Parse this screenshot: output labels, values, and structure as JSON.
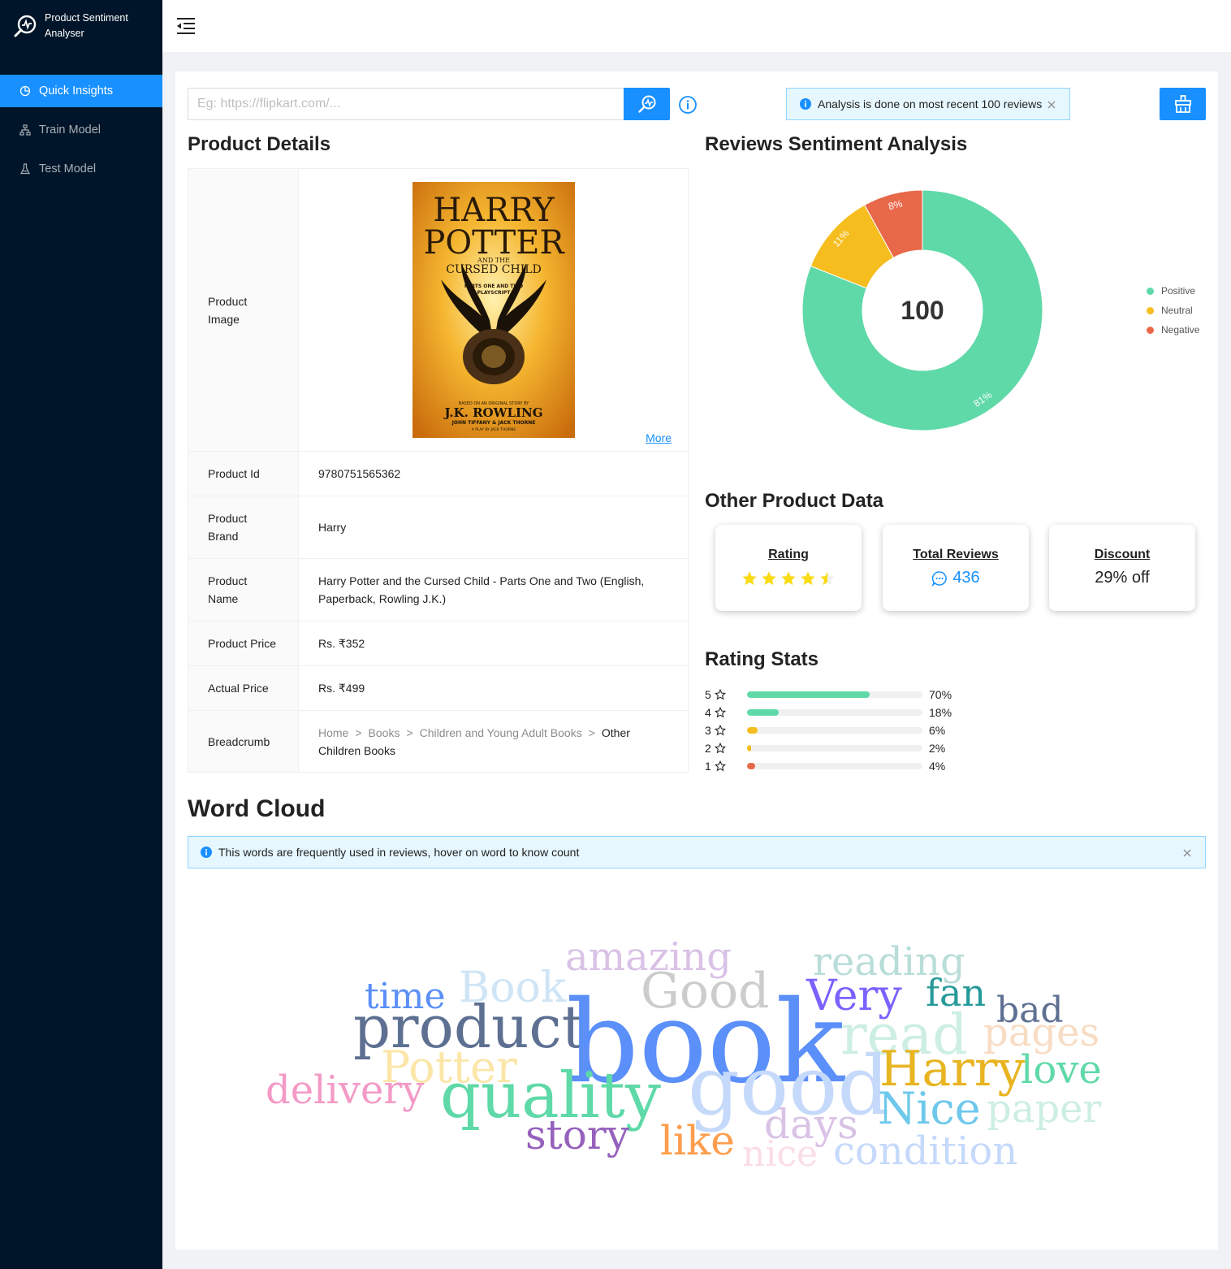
{
  "app": {
    "title": "Product Sentiment Analyser"
  },
  "menu": [
    {
      "label": "Quick Insights",
      "icon": "pie-chart-icon",
      "active": true
    },
    {
      "label": "Train Model",
      "icon": "cluster-icon",
      "active": false
    },
    {
      "label": "Test Model",
      "icon": "experiment-icon",
      "active": false
    }
  ],
  "search": {
    "placeholder": "Eg: https://flipkart.com/...",
    "value": ""
  },
  "alert_top": {
    "text": "Analysis is done on most recent 100 reviews"
  },
  "sections": {
    "product_details": "Product Details",
    "sentiment": "Reviews Sentiment Analysis",
    "other": "Other Product Data",
    "rating_stats": "Rating Stats",
    "word_cloud": "Word Cloud"
  },
  "product": {
    "image_label": "Product Image",
    "more": "More",
    "rows": [
      {
        "label": "Product Id",
        "value": "9780751565362"
      },
      {
        "label": "Product Brand",
        "value": "Harry"
      },
      {
        "label": "Product Name",
        "value": "Harry Potter and the Cursed Child - Parts One and Two  (English, Paperback, Rowling J.K.)"
      },
      {
        "label": "Product Price",
        "value": "Rs. ₹352"
      },
      {
        "label": "Actual Price",
        "value": "Rs. ₹499"
      }
    ],
    "breadcrumb_label": "Breadcrumb",
    "breadcrumb": [
      "Home",
      "Books",
      "Children and Young Adult Books",
      "Other Children Books"
    ],
    "cover": {
      "title1": "HARRY",
      "title2": "POTTER",
      "and_the": "AND THE",
      "subtitle": "CURSED CHILD",
      "parts1": "PARTS ONE AND TWO",
      "parts2": "PLAYSCRIPT",
      "based": "BASED ON AN ORIGINAL STORY BY",
      "author": "J.K. ROWLING",
      "coauthors": "JOHN TIFFANY & JACK THORNE",
      "play": "A PLAY BY JACK THORNE"
    }
  },
  "chart_data": {
    "type": "pie",
    "center_label": "100",
    "series": [
      {
        "name": "Positive",
        "value": 81,
        "label": "81%",
        "color": "#5fd9a8"
      },
      {
        "name": "Neutral",
        "value": 11,
        "label": "11%",
        "color": "#f5bd1e"
      },
      {
        "name": "Negative",
        "value": 8,
        "label": "8%",
        "color": "#e8684a"
      }
    ],
    "legend_position": "right"
  },
  "cards": {
    "rating": {
      "title": "Rating",
      "stars": 4.5
    },
    "reviews": {
      "title": "Total Reviews",
      "value": "436"
    },
    "discount": {
      "title": "Discount",
      "value": "29% off"
    }
  },
  "rating_stats": [
    {
      "stars": "5",
      "percent": 70,
      "label": "70%",
      "color": "#5fd9a8"
    },
    {
      "stars": "4",
      "percent": 18,
      "label": "18%",
      "color": "#5fd9a8"
    },
    {
      "stars": "3",
      "percent": 6,
      "label": "6%",
      "color": "#f5bd1e"
    },
    {
      "stars": "2",
      "percent": 2,
      "label": "2%",
      "color": "#f5bd1e"
    },
    {
      "stars": "1",
      "percent": 4,
      "label": "4%",
      "color": "#e8684a"
    }
  ],
  "alert_wc": {
    "text": "This words are frequently used in reviews, hover on word to know count"
  },
  "word_cloud": [
    {
      "word": "amazing",
      "color": "#d9c2e6"
    },
    {
      "word": "reading",
      "color": "#b9ddd8"
    },
    {
      "word": "time",
      "color": "#5b8ff9"
    },
    {
      "word": "Book",
      "color": "#cfe5f5"
    },
    {
      "word": "Good",
      "color": "#cccccc"
    },
    {
      "word": "Very",
      "color": "#7b61ff"
    },
    {
      "word": "fan",
      "color": "#269a99"
    },
    {
      "word": "bad",
      "color": "#5d7092"
    },
    {
      "word": "product",
      "color": "#5d7092"
    },
    {
      "word": "book",
      "color": "#5b8ff9"
    },
    {
      "word": "read",
      "color": "#cdeee4"
    },
    {
      "word": "pages",
      "color": "#f8dcc3"
    },
    {
      "word": "Potter",
      "color": "#fbe6a8"
    },
    {
      "word": "Harry",
      "color": "#e8b420"
    },
    {
      "word": "love",
      "color": "#5fd9a8"
    },
    {
      "word": "delivery",
      "color": "#f39ac6"
    },
    {
      "word": "quality",
      "color": "#5fd9a8"
    },
    {
      "word": "good",
      "color": "#c5d9fb"
    },
    {
      "word": "Nice",
      "color": "#6dc8ec"
    },
    {
      "word": "paper",
      "color": "#cdeee4"
    },
    {
      "word": "story",
      "color": "#9661bc"
    },
    {
      "word": "like",
      "color": "#ff9d4d"
    },
    {
      "word": "days",
      "color": "#d9c2e6"
    },
    {
      "word": "nice",
      "color": "#fadde6"
    },
    {
      "word": "condition",
      "color": "#c5d9fb"
    }
  ]
}
